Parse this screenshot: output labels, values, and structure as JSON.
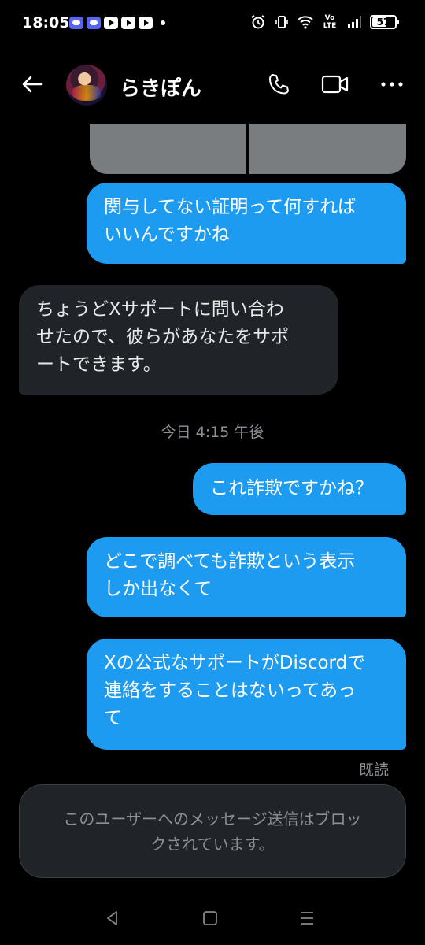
{
  "status_bar": {
    "time": "18:05",
    "notifications": [
      "discord-icon",
      "discord-icon",
      "youtube-icon",
      "youtube-icon",
      "youtube-icon"
    ],
    "network": "Vo LTE",
    "battery": "57"
  },
  "header": {
    "contact_name": "らきぽん",
    "icons": [
      "back-arrow-icon",
      "phone-icon",
      "video-camera-icon",
      "more-icon"
    ]
  },
  "messages": [
    {
      "direction": "out",
      "text": "関与してない証明って何すれば\nいいんですかね"
    },
    {
      "direction": "in",
      "text": "ちょうどXサポートに問い合わ\nせたので、彼らがあなたをサポ\nートできます。"
    },
    {
      "direction": "out",
      "text": "これ詐欺ですかね？"
    },
    {
      "direction": "out",
      "text": "どこで調べても詐欺という表示\nしか出なくて"
    },
    {
      "direction": "out",
      "text": "Xの公式なサポートがDiscordで\n連絡をすることはないってあっ\nて"
    }
  ],
  "timestamp": "今日 4:15 午後",
  "read_receipt": "既読",
  "blocked_notice": "このユーザーへのメッセージ送信はブロッ\nクされています。",
  "colors": {
    "background": "#000000",
    "outgoing_bubble": "#1d9bf0",
    "incoming_bubble": "#202327",
    "muted_text": "#8b9096"
  }
}
